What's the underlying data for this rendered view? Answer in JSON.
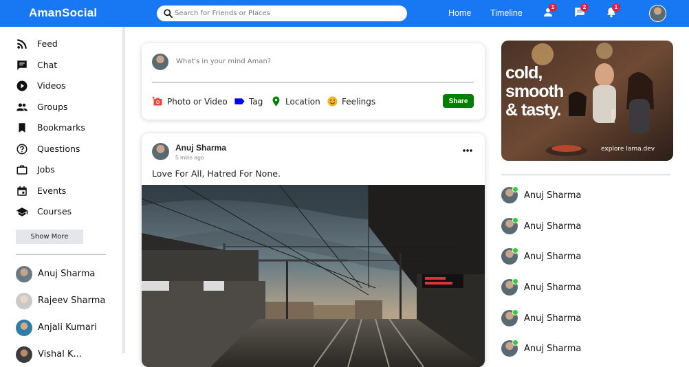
{
  "header": {
    "logo": "AmanSocial",
    "search_placeholder": "Search for Friends or Places",
    "nav": [
      "Home",
      "Timeline"
    ],
    "badges": {
      "friends": "1",
      "messages": "2",
      "notifications": "1"
    },
    "brand_color": "#1877f2"
  },
  "sidebar": {
    "items": [
      {
        "label": "Feed",
        "icon": "rss-icon"
      },
      {
        "label": "Chat",
        "icon": "chat-icon"
      },
      {
        "label": "Videos",
        "icon": "play-circle-icon"
      },
      {
        "label": "Groups",
        "icon": "group-icon"
      },
      {
        "label": "Bookmarks",
        "icon": "bookmark-icon"
      },
      {
        "label": "Questions",
        "icon": "help-circle-icon"
      },
      {
        "label": "Jobs",
        "icon": "briefcase-icon"
      },
      {
        "label": "Events",
        "icon": "calendar-icon"
      },
      {
        "label": "Courses",
        "icon": "school-icon"
      }
    ],
    "show_more": "Show More",
    "friends": [
      "Anuj Sharma",
      "Rajeev Sharma",
      "Anjali Kumari",
      "Vishal K..."
    ]
  },
  "share": {
    "placeholder": "What's in your mind Aman?",
    "options": [
      "Photo or Video",
      "Tag",
      "Location",
      "Feelings"
    ],
    "button": "Share"
  },
  "post": {
    "author": "Anuj Sharma",
    "time": "5 mins ago",
    "text": "Love For All, Hatred For None."
  },
  "rightbar": {
    "ad_lines": [
      "cold,",
      "smooth",
      "& tasty."
    ],
    "ad_footer": "explore lama.dev",
    "online_friends": [
      "Anuj Sharma",
      "Anuj Sharma",
      "Anuj Sharma",
      "Anuj Sharma",
      "Anuj Sharma",
      "Anuj Sharma"
    ]
  }
}
